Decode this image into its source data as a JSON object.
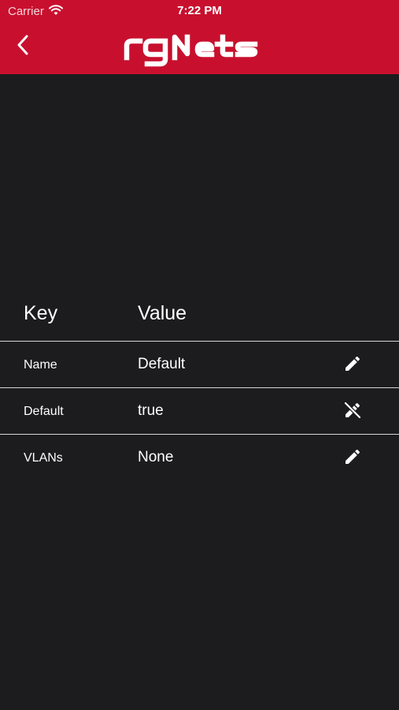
{
  "status_bar": {
    "carrier": "Carrier",
    "time": "7:22 PM"
  },
  "header": {
    "logo": "rgNets",
    "brand_color": "#c8102e"
  },
  "table": {
    "headers": {
      "key": "Key",
      "value": "Value"
    },
    "rows": [
      {
        "key": "Name",
        "value": "Default",
        "action_icon": "edit-icon"
      },
      {
        "key": "Default",
        "value": "true",
        "action_icon": "edit-disabled-icon"
      },
      {
        "key": "VLANs",
        "value": "None",
        "action_icon": "edit-icon"
      }
    ]
  }
}
